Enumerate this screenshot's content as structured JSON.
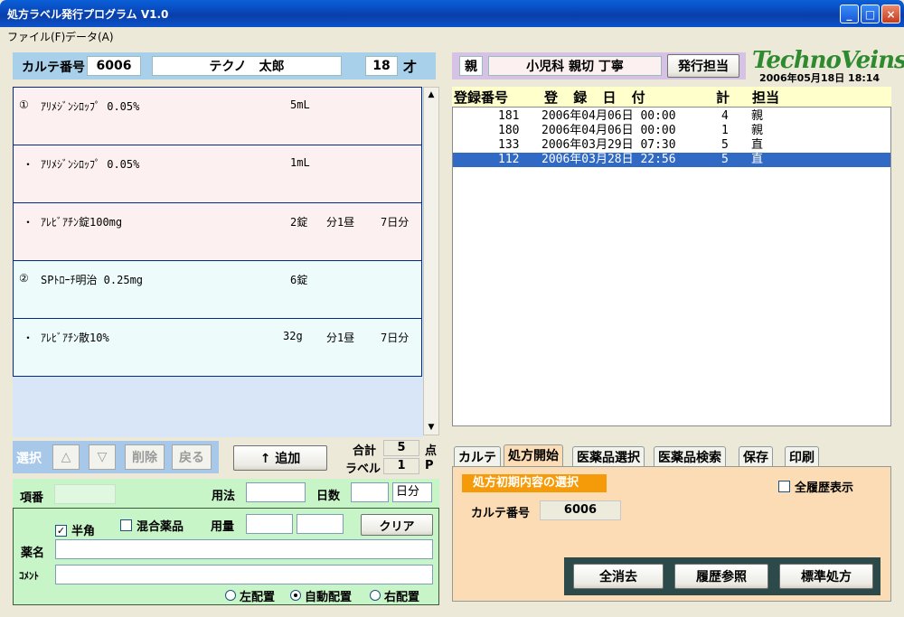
{
  "window": {
    "title": "処方ラベル発行プログラム V1.0",
    "min": "_",
    "max": "□",
    "close": "×"
  },
  "menu": {
    "file": "ファイル(F)",
    "data": "データ(A)"
  },
  "patient": {
    "karte_label": "カルテ番号",
    "karte_no": "6006",
    "name": "テクノ　太郎",
    "age": "18",
    "age_unit": "才"
  },
  "rx_items": [
    {
      "mark": "①",
      "drug": "ｱﾘﾒｼﾞﾝｼﾛｯﾌﾟ 0.05%",
      "amount": "5mL",
      "usage": "",
      "days": ""
    },
    {
      "mark": "・",
      "drug": "ｱﾘﾒｼﾞﾝｼﾛｯﾌﾟ 0.05%",
      "amount": "1mL",
      "usage": "",
      "days": ""
    },
    {
      "mark": "・",
      "drug": "ｱﾚﾋﾞｱﾁﾝ錠100mg",
      "amount": "2錠",
      "usage": "分1昼",
      "days": "7日分"
    },
    {
      "mark": "②",
      "drug": "SPﾄﾛｰﾁ明治 0.25mg",
      "amount": "6錠",
      "usage": "",
      "days": ""
    },
    {
      "mark": "・",
      "drug": "ｱﾚﾋﾞｱﾁﾝ散10%",
      "amount": "32g",
      "usage": "分1昼",
      "days": "7日分"
    }
  ],
  "controls": {
    "select": "選択",
    "up": "△",
    "down": "▽",
    "delete": "削除",
    "back": "戻る",
    "add": "↑ 追加",
    "total_label": "合計",
    "total_value": "5",
    "total_unit": "点",
    "label_label": "ラベル",
    "label_value": "1",
    "label_unit": "P"
  },
  "form": {
    "item_no": "項番",
    "usage": "用法",
    "days": "日数",
    "days_unit": "日分",
    "halfwidth": "半角",
    "mixed": "混合薬品",
    "dose": "用量",
    "clear": "クリア",
    "drug_name": "薬名",
    "comment": "ｺﾒﾝﾄ",
    "align_left": "左配置",
    "align_auto": "自動配置",
    "align_right": "右配置"
  },
  "parent": {
    "label": "親",
    "dept": "小児科 親切 丁寧",
    "issuer_button": "発行担当"
  },
  "logo": "TechnoVeins",
  "datetime": "2006年05月18日 18:14",
  "registry": {
    "headers": [
      "登録番号",
      "登 録 日 付",
      "計",
      "担当"
    ],
    "rows": [
      {
        "no": "181",
        "date": "2006年04月06日 00:00",
        "count": "4",
        "staff": "親"
      },
      {
        "no": "180",
        "date": "2006年04月06日 00:00",
        "count": "1",
        "staff": "親"
      },
      {
        "no": "133",
        "date": "2006年03月29日 07:30",
        "count": "5",
        "staff": "直"
      },
      {
        "no": "112",
        "date": "2006年03月28日 22:56",
        "count": "5",
        "staff": "直"
      }
    ]
  },
  "tabs": [
    "カルテ",
    "処方開始",
    "医薬品選択",
    "医薬品検索",
    "保存",
    "印刷"
  ],
  "panel": {
    "heading": "処方初期内容の選択",
    "show_all": "全履歴表示",
    "karte_label": "カルテ番号",
    "karte_no": "6006",
    "clear_all": "全消去",
    "history": "履歴参照",
    "standard": "標準処方"
  }
}
